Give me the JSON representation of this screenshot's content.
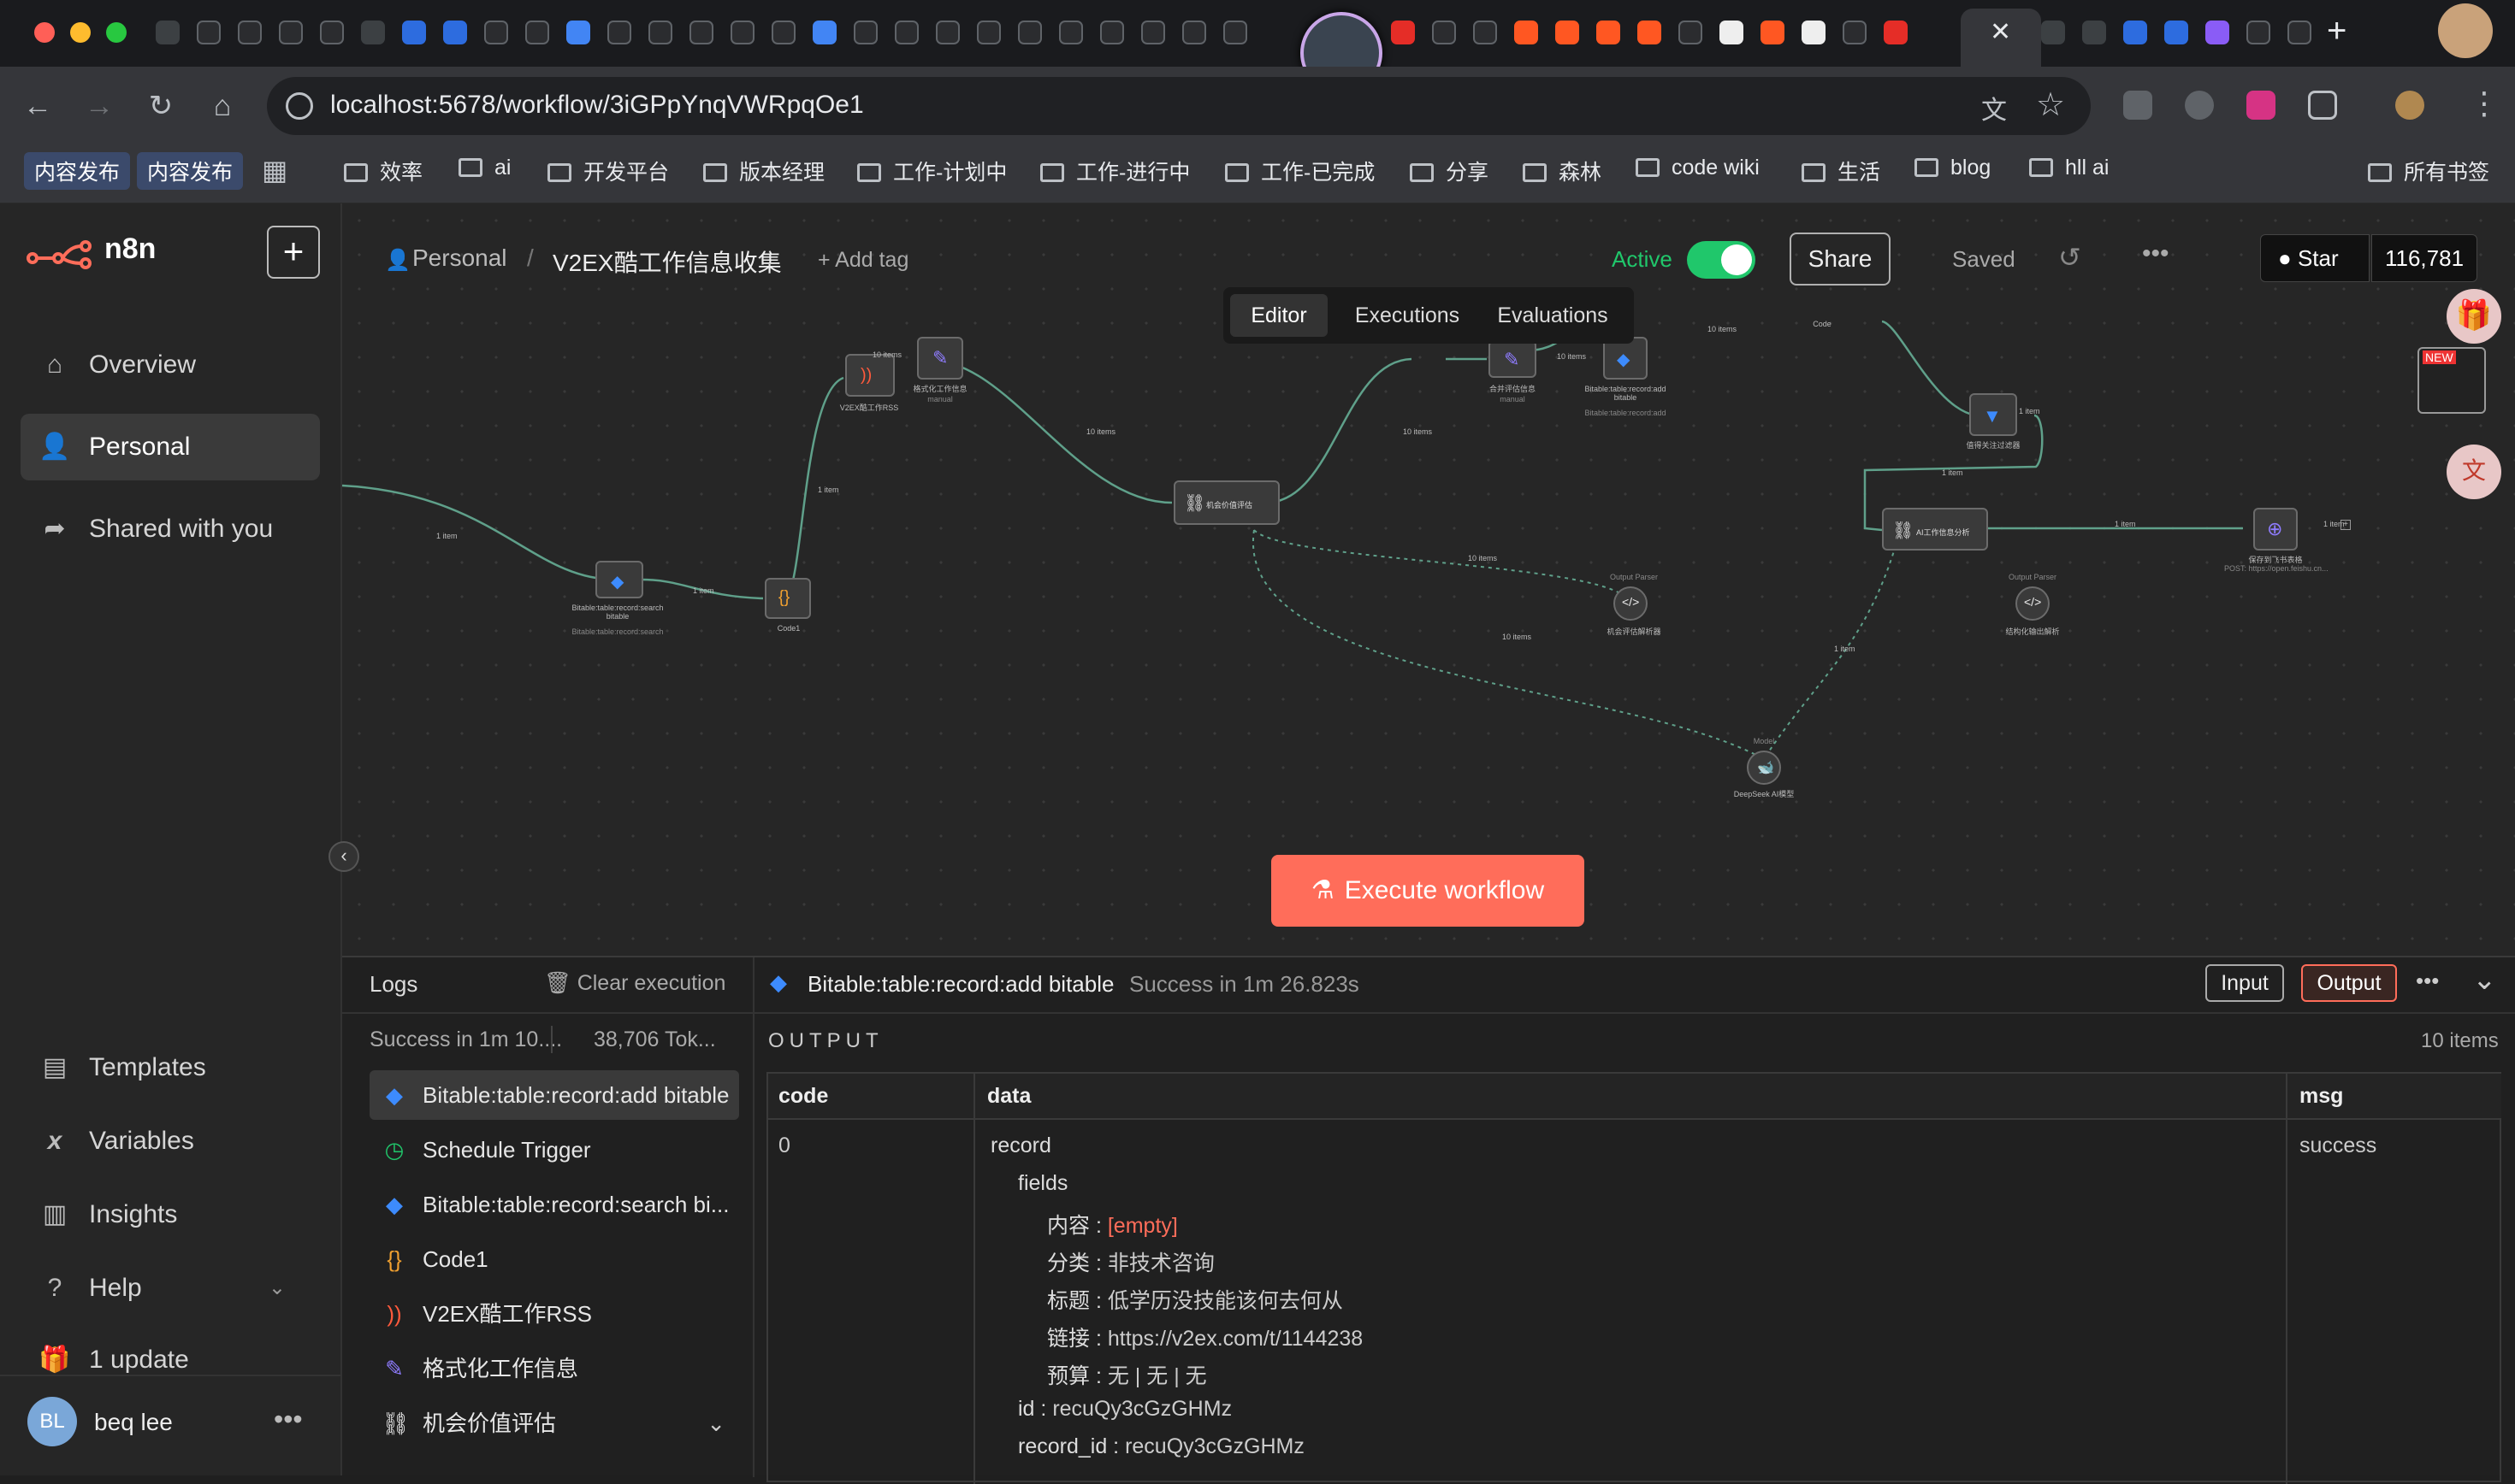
{
  "browser": {
    "url": "localhost:5678/workflow/3iGPpYnqVWRpqOe1",
    "bookmarks": [
      "内容发布",
      "内容发布",
      "效率",
      "ai",
      "开发平台",
      "版本经理",
      "工作-计划中",
      "工作-进行中",
      "工作-已完成",
      "分享",
      "森林",
      "code wiki",
      "生活",
      "blog",
      "hll ai",
      "所有书签"
    ]
  },
  "app": {
    "logo_text": "n8n",
    "nav": {
      "overview": "Overview",
      "personal": "Personal",
      "shared": "Shared with you",
      "templates": "Templates",
      "variables": "Variables",
      "insights": "Insights",
      "help": "Help",
      "update": "1 update"
    },
    "user": {
      "initials": "BL",
      "name": "beq lee"
    }
  },
  "header": {
    "breadcrumb_project": "Personal",
    "breadcrumb_sep": "/",
    "workflow_name": "V2EX酷工作信息收集",
    "add_tag": "+ Add tag",
    "active_label": "Active",
    "share": "Share",
    "saved": "Saved",
    "star": "Star",
    "star_count": "116,781",
    "tabs": [
      "Editor",
      "Executions",
      "Evaluations"
    ]
  },
  "canvas": {
    "nodes": [
      {
        "label": "Bitable:table:record:search bitable",
        "sub": "Bitable:table:record:search"
      },
      {
        "label": "Code1"
      },
      {
        "label": "V2EX酷工作RSS"
      },
      {
        "label": "格式化工作信息",
        "sub": "manual"
      },
      {
        "label": "机会价值评估"
      },
      {
        "label": "合并评估信息",
        "sub": "manual"
      },
      {
        "label": "Bitable:table:record:add bitable",
        "sub": "Bitable:table:record:add"
      },
      {
        "label": "Code"
      },
      {
        "label": "值得关注过滤器"
      },
      {
        "label": "AI工作信息分析"
      },
      {
        "label": "保存到飞书表格",
        "sub": "POST: https://open.feishu.cn..."
      },
      {
        "label": "机会评估解析器",
        "sub": "Output Parser"
      },
      {
        "label": "结构化输出解析",
        "sub": "Output Parser"
      },
      {
        "label": "DeepSeek AI模型",
        "sub": "Model"
      }
    ],
    "edge_labels": [
      "1 item",
      "1 item",
      "1 item",
      "10 items",
      "10 items",
      "10 items",
      "10 items",
      "10 items",
      "1 item",
      "1 item",
      "1 item",
      "10 items",
      "10 items",
      "1 item",
      "1 item"
    ],
    "execute_button": "Execute workflow"
  },
  "logs": {
    "title": "Logs",
    "clear": "Clear execution",
    "summary_left": "Success in 1m 10....",
    "summary_right": "38,706 Tok...",
    "entries": [
      {
        "label": "Bitable:table:record:add bitable",
        "icon": "bitable-icon"
      },
      {
        "label": "Schedule Trigger",
        "icon": "clock-icon"
      },
      {
        "label": "Bitable:table:record:search bi...",
        "icon": "bitable-icon"
      },
      {
        "label": "Code1",
        "icon": "code-icon"
      },
      {
        "label": "V2EX酷工作RSS",
        "icon": "rss-icon"
      },
      {
        "label": "格式化工作信息",
        "icon": "pen-icon"
      },
      {
        "label": "机会价值评估",
        "icon": "link-icon"
      }
    ],
    "selected_node": "Bitable:table:record:add bitable",
    "selected_status": "Success in 1m 26.823s",
    "input_btn": "Input",
    "output_btn": "Output",
    "output_title": "OUTPUT",
    "item_count": "10 items",
    "columns": [
      "code",
      "data",
      "msg"
    ],
    "row": {
      "code": "0",
      "msg": "success",
      "record": "record",
      "fields": "fields",
      "f1k": "内容",
      "f1v": "[empty]",
      "f2k": "分类",
      "f2v": "非技术咨询",
      "f3k": "标题",
      "f3v": "低学历没技能该何去何从",
      "f4k": "链接",
      "f4v": "https://v2ex.com/t/1144238",
      "f5k": "预算",
      "f5v": "无 | 无 | 无",
      "idk": "id",
      "idv": "recuQy3cGzGHMz",
      "ridk": "record_id",
      "ridv": "recuQy3cGzGHMz"
    }
  },
  "colors": {
    "accent": "#ff6d5a",
    "success": "#00c389",
    "active_green": "#20c76b"
  }
}
